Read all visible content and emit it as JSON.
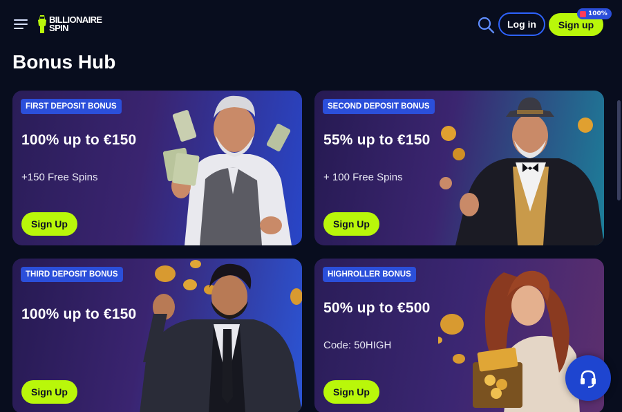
{
  "header": {
    "logo_line1": "BILLIONAIRE",
    "logo_line2": "SPIN",
    "login_label": "Log in",
    "signup_label": "Sign up",
    "signup_badge": "100%",
    "icons": [
      "menu-icon",
      "search-icon",
      "gift-icon"
    ]
  },
  "page": {
    "title": "Bonus Hub"
  },
  "cards": [
    {
      "tag": "FIRST DEPOSIT BONUS",
      "offer": "100% up to €150",
      "sub": "+150 Free Spins",
      "button": "Sign Up"
    },
    {
      "tag": "SECOND DEPOSIT BONUS",
      "offer": "55% up to €150",
      "sub": "+ 100 Free Spins",
      "button": "Sign Up"
    },
    {
      "tag": "THIRD DEPOSIT BONUS",
      "offer": "100% up to €150",
      "sub": "",
      "button": "Sign Up"
    },
    {
      "tag": "HIGHROLLER BONUS",
      "offer": "50% up to €500",
      "sub": "Code: 50HIGH",
      "button": "Sign Up"
    }
  ],
  "support": {
    "icon": "headset-icon"
  },
  "colors": {
    "accent": "#b9f70a",
    "background": "#080d1e",
    "tag_blue": "#2b4fda",
    "outline_blue": "#2e63ff"
  }
}
